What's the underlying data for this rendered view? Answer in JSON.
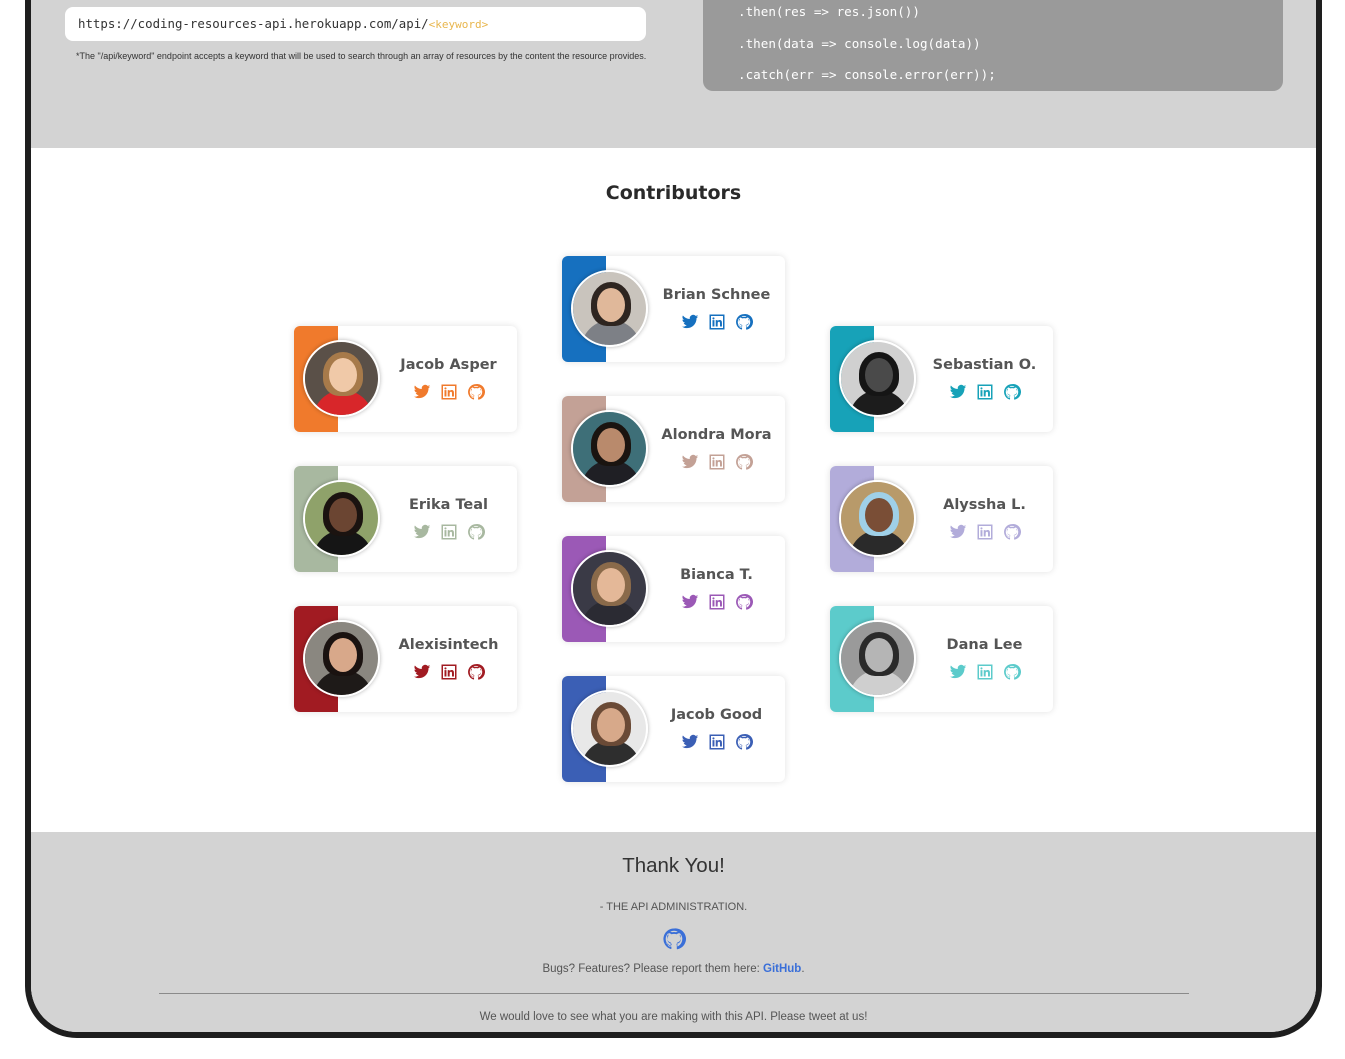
{
  "api": {
    "url_base": "https://coding-resources-api.herokuapp.com/api/",
    "url_keyword": "<keyword>",
    "note": "*The \"/api/keyword\" endpoint accepts a keyword that will be used to search through an array of resources by the content the resource provides."
  },
  "code": {
    "lines": [
      ".then(res => res.json())",
      ".then(data => console.log(data))",
      ".catch(err => console.error(err));"
    ]
  },
  "contributors": {
    "title": "Contributors",
    "people": [
      {
        "name": "Brian Schnee",
        "color": "#1670bf"
      },
      {
        "name": "Jacob Asper",
        "color": "#f07a2c"
      },
      {
        "name": "Sebastian O.",
        "color": "#17a2b8"
      },
      {
        "name": "Alondra Mora",
        "color": "#c3a196"
      },
      {
        "name": "Erika Teal",
        "color": "#a8b8a0"
      },
      {
        "name": "Alyssha L.",
        "color": "#b2acda"
      },
      {
        "name": "Bianca T.",
        "color": "#9b59b6"
      },
      {
        "name": "Alexisintech",
        "color": "#a11b22"
      },
      {
        "name": "Dana Lee",
        "color": "#5ccbcb"
      },
      {
        "name": "Jacob Good",
        "color": "#3b5fb5"
      }
    ],
    "icons": [
      "twitter-icon",
      "linkedin-icon",
      "github-icon"
    ]
  },
  "footer": {
    "thanks": "Thank You!",
    "admin": "- THE API ADMINISTRATION.",
    "bugs_text": "Bugs? Features? Please report them here: ",
    "bugs_link": "GitHub",
    "bugs_end": ".",
    "tweet": "We would love to see what you are making with this API. Please tweet at us!",
    "link_color": "#3a6fd8"
  }
}
